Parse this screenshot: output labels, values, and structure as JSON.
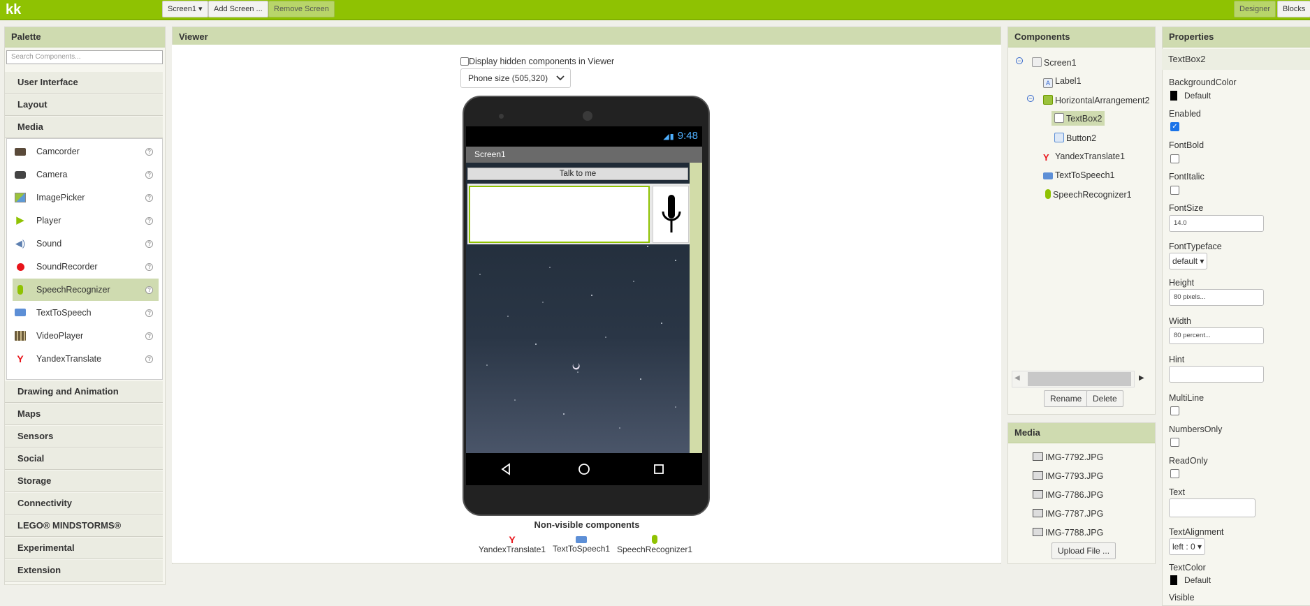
{
  "topbar": {
    "project": "kk",
    "screen_select": "Screen1 ▾",
    "add_screen": "Add Screen ...",
    "remove_screen": "Remove Screen",
    "designer": "Designer",
    "blocks": "Blocks"
  },
  "palette": {
    "title": "Palette",
    "search_placeholder": "Search Components...",
    "categories_top": [
      "User Interface",
      "Layout",
      "Media"
    ],
    "media_items": [
      {
        "label": "Camcorder",
        "icon": "camcorder-icon"
      },
      {
        "label": "Camera",
        "icon": "camera-icon"
      },
      {
        "label": "ImagePicker",
        "icon": "imagepicker-icon"
      },
      {
        "label": "Player",
        "icon": "player-icon"
      },
      {
        "label": "Sound",
        "icon": "sound-icon"
      },
      {
        "label": "SoundRecorder",
        "icon": "soundrecorder-icon"
      },
      {
        "label": "SpeechRecognizer",
        "icon": "speechrecognizer-icon"
      },
      {
        "label": "TextToSpeech",
        "icon": "texttospeech-icon"
      },
      {
        "label": "VideoPlayer",
        "icon": "videoplayer-icon"
      },
      {
        "label": "YandexTranslate",
        "icon": "yandex-icon"
      }
    ],
    "categories_bottom": [
      "Drawing and Animation",
      "Maps",
      "Sensors",
      "Social",
      "Storage",
      "Connectivity",
      "LEGO® MINDSTORMS®",
      "Experimental",
      "Extension"
    ],
    "help_glyph": "?"
  },
  "viewer": {
    "title": "Viewer",
    "hidden_checkbox_label": "Display hidden components in Viewer",
    "phone_size": "Phone size (505,320)",
    "time": "9:48",
    "screen_title": "Screen1",
    "talk_button": "Talk to me",
    "nonvisible_title": "Non-visible components",
    "nonvisible": [
      "YandexTranslate1",
      "TextToSpeech1",
      "SpeechRecognizer1"
    ]
  },
  "components": {
    "title": "Components",
    "tree": [
      "Screen1",
      "Label1",
      "HorizontalArrangement2",
      "TextBox2",
      "Button2",
      "YandexTranslate1",
      "TextToSpeech1",
      "SpeechRecognizer1"
    ],
    "rename": "Rename",
    "delete": "Delete"
  },
  "media": {
    "title": "Media",
    "files": [
      "IMG-7792.JPG",
      "IMG-7793.JPG",
      "IMG-7786.JPG",
      "IMG-7787.JPG",
      "IMG-7788.JPG"
    ],
    "upload": "Upload File ..."
  },
  "properties": {
    "title": "Properties",
    "component": "TextBox2",
    "bg_label": "BackgroundColor",
    "bg_value": "Default",
    "enabled_label": "Enabled",
    "enabled": true,
    "fontbold_label": "FontBold",
    "fontitalic_label": "FontItalic",
    "fontsize_label": "FontSize",
    "fontsize": "14.0",
    "typeface_label": "FontTypeface",
    "typeface": "default ▾",
    "height_label": "Height",
    "height": "80 pixels...",
    "width_label": "Width",
    "width": "80 percent...",
    "hint_label": "Hint",
    "multiline_label": "MultiLine",
    "numbersonly_label": "NumbersOnly",
    "readonly_label": "ReadOnly",
    "text_label": "Text",
    "textalign_label": "TextAlignment",
    "textalign": "left : 0 ▾",
    "textcolor_label": "TextColor",
    "textcolor": "Default",
    "visible_label": "Visible"
  },
  "colors": {
    "accent": "#8fc202",
    "header": "#cfdbb0"
  }
}
